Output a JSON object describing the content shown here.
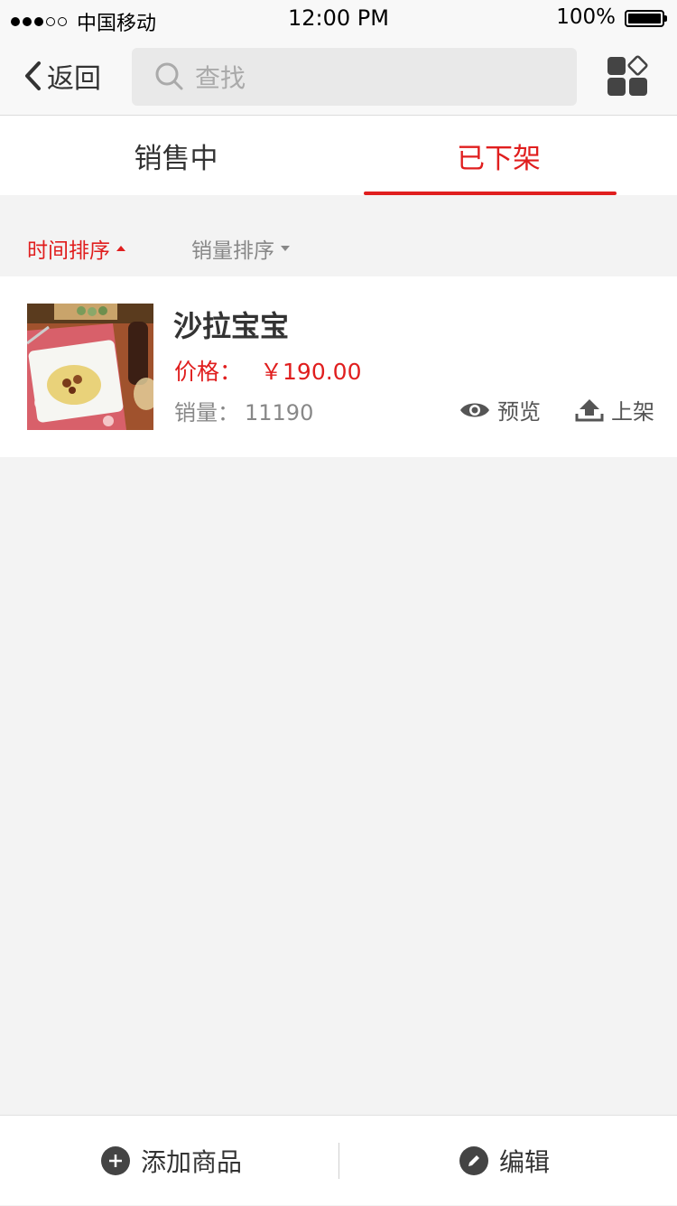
{
  "status_bar": {
    "carrier": "中国移动",
    "time": "12:00 PM",
    "battery": "100%",
    "signal_filled": 3,
    "signal_total": 5
  },
  "nav": {
    "back_label": "返回",
    "search_placeholder": "查找"
  },
  "tabs": [
    {
      "label": "销售中",
      "active": false
    },
    {
      "label": "已下架",
      "active": true
    }
  ],
  "sort": {
    "time_label": "时间排序",
    "sales_label": "销量排序"
  },
  "product": {
    "name": "沙拉宝宝",
    "price_label": "价格：",
    "price": "￥190.00",
    "sales_label": "销量：",
    "sales": "11190",
    "preview_label": "预览",
    "shelve_label": "上架"
  },
  "bottom": {
    "add_label": "添加商品",
    "edit_label": "编辑"
  },
  "colors": {
    "accent": "#e01e1e",
    "background": "#f3f3f3",
    "icon": "#444444"
  },
  "icons": [
    "back-chevron-icon",
    "search-icon",
    "grid-menu-icon",
    "eye-icon",
    "upload-icon",
    "plus-circle-icon",
    "pencil-circle-icon"
  ]
}
